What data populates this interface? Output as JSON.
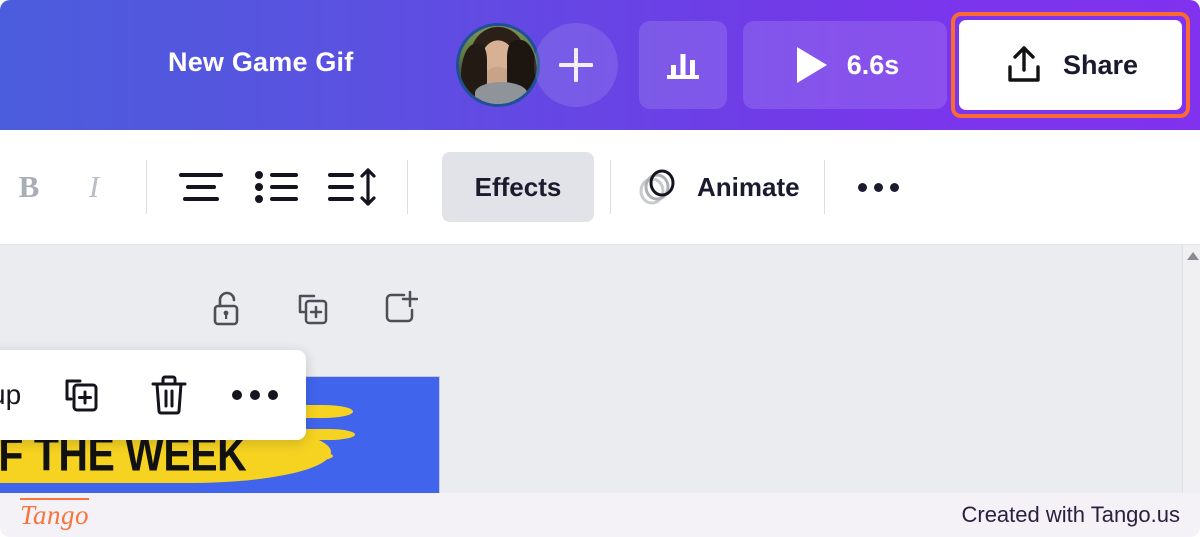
{
  "header": {
    "title": "New Game Gif",
    "avatar_name": "user-avatar",
    "add_collaborator_label": "+",
    "timeline_icon": "bar-chart-icon",
    "play_icon": "play-icon",
    "duration": "6.6s",
    "share_label": "Share",
    "share_icon": "upload-share-icon",
    "highlight_color": "#fa6a32",
    "gradient_from": "#4b5ddc",
    "gradient_to": "#8032ee"
  },
  "toolbar": {
    "bold_label": "B",
    "italic_label": "I",
    "align_icon": "text-align-center-icon",
    "list_icon": "bullet-list-icon",
    "line_spacing_icon": "line-spacing-icon",
    "effects_label": "Effects",
    "animate_label": "Animate",
    "animate_icon": "animate-circles-icon",
    "more_label": "•••"
  },
  "canvas": {
    "page_tools": [
      {
        "name": "unlock-icon",
        "label": "Unlock"
      },
      {
        "name": "duplicate-page-icon",
        "label": "Duplicate page"
      },
      {
        "name": "add-page-icon",
        "label": "Add page"
      }
    ],
    "artboard": {
      "text": "OF THE WEEK",
      "background_color": "#4164ec",
      "brush_color": "#f6d320",
      "text_color": "#121212"
    },
    "context_menu": {
      "group_label": "up",
      "duplicate_icon": "duplicate-icon",
      "delete_icon": "trash-icon",
      "more_icon": "more-horizontal-icon"
    },
    "scrollbar": {
      "up_arrow": "scroll-up-arrow-icon"
    }
  },
  "footer": {
    "logo": "Tango",
    "credit": "Created with Tango.us",
    "logo_color": "#f8743c"
  }
}
